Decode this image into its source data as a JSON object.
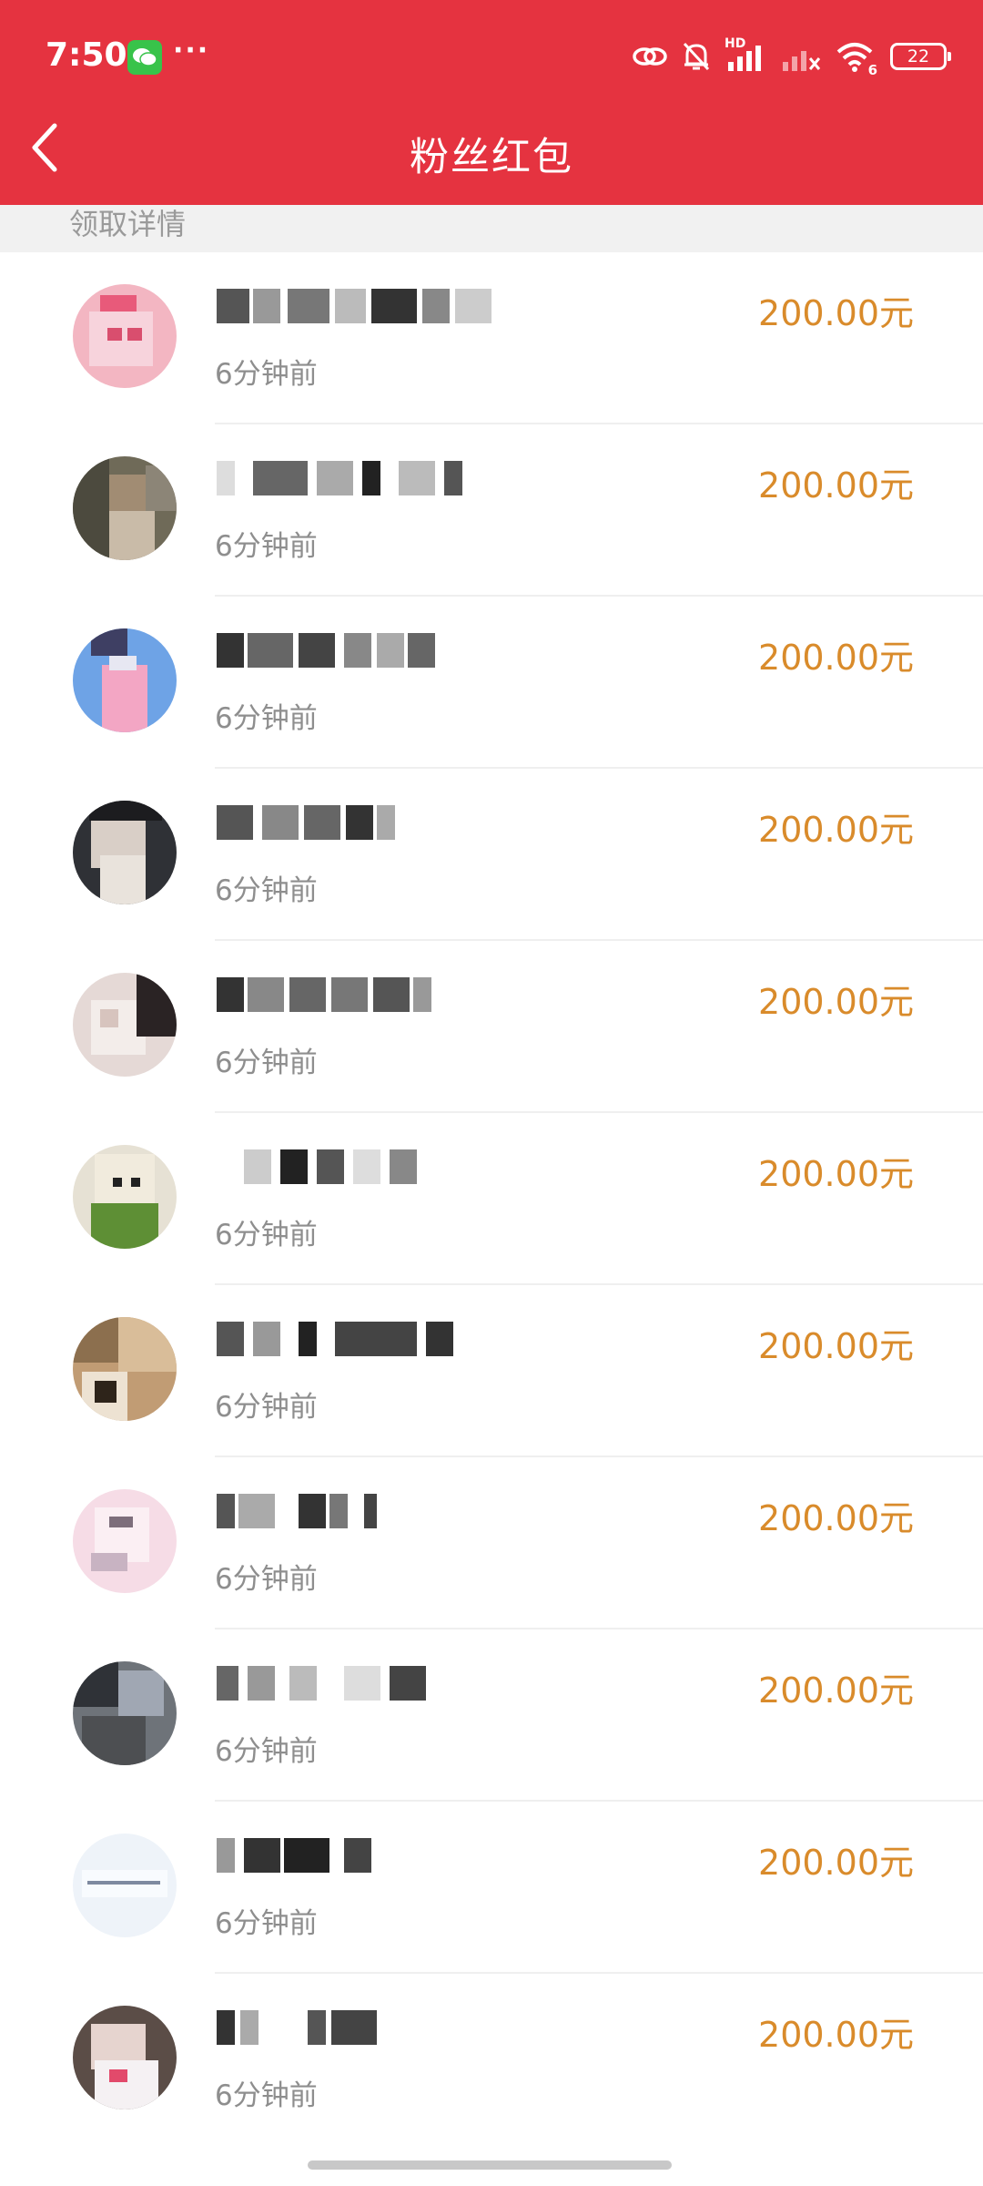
{
  "status_bar": {
    "time": "7:50",
    "dots": "···",
    "battery": "22",
    "icons": [
      "wechat-icon",
      "link-icon",
      "mute-bell-icon",
      "hd-signal-icon",
      "signal-x-icon",
      "wifi-icon",
      "battery-icon"
    ],
    "network_label": "HD",
    "wifi_index": "6"
  },
  "header": {
    "title": "粉丝红包",
    "back_icon": "chevron-left-icon",
    "background_color": "#E53340"
  },
  "section": {
    "title": "领取详情"
  },
  "list": {
    "amount_color": "#D98B2B",
    "items": [
      {
        "time": "6分钟前",
        "amount": "200.00元"
      },
      {
        "time": "6分钟前",
        "amount": "200.00元"
      },
      {
        "time": "6分钟前",
        "amount": "200.00元"
      },
      {
        "time": "6分钟前",
        "amount": "200.00元"
      },
      {
        "time": "6分钟前",
        "amount": "200.00元"
      },
      {
        "time": "6分钟前",
        "amount": "200.00元"
      },
      {
        "time": "6分钟前",
        "amount": "200.00元"
      },
      {
        "time": "6分钟前",
        "amount": "200.00元"
      },
      {
        "time": "6分钟前",
        "amount": "200.00元"
      },
      {
        "time": "6分钟前",
        "amount": "200.00元"
      },
      {
        "time": "6分钟前",
        "amount": "200.00元"
      }
    ]
  }
}
